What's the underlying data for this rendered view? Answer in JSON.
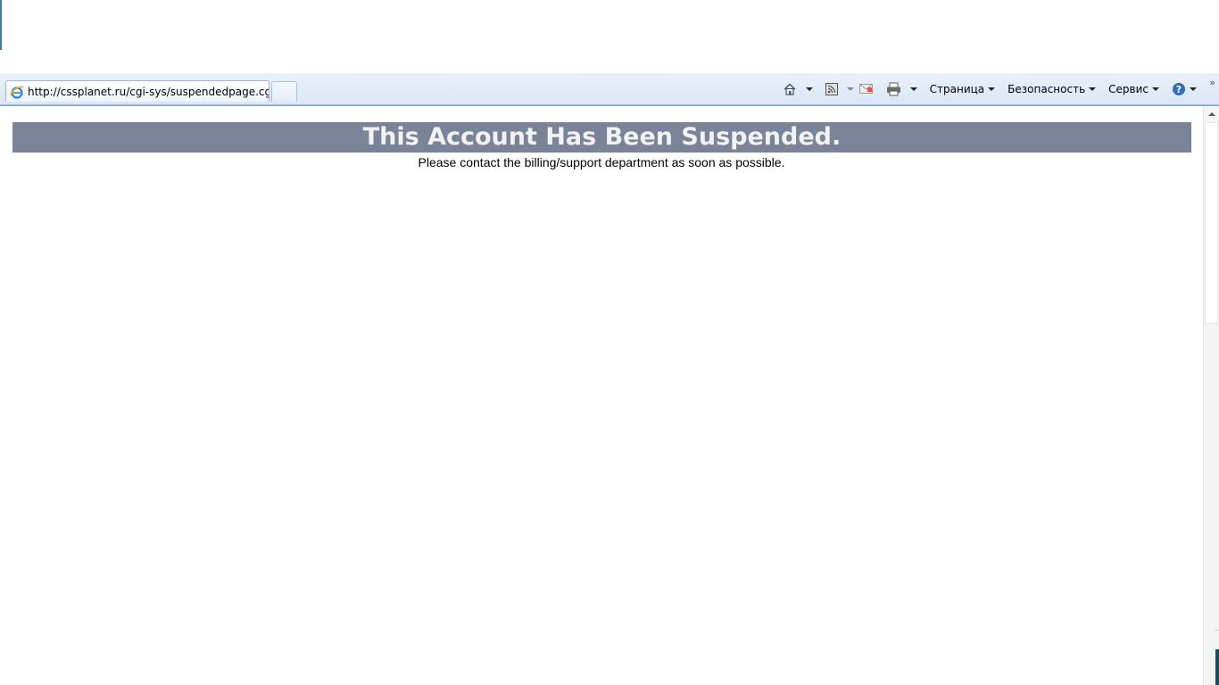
{
  "tab": {
    "url": "http://cssplanet.ru/cgi-sys/suspendedpage.cgi"
  },
  "toolbar": {
    "page_menu": "Страница",
    "security_menu": "Безопасность",
    "service_menu": "Сервис",
    "overflow": "»"
  },
  "icons": {
    "browser": "ie-icon",
    "home": "home-icon",
    "feeds": "rss-icon",
    "mail": "mail-icon",
    "print": "print-icon",
    "help": "help-icon"
  },
  "page": {
    "heading": "This Account Has Been Suspended.",
    "message": "Please contact the billing/support department as soon as possible."
  },
  "colors": {
    "banner_bg": "#7a8499",
    "banner_text": "#f2f2f2",
    "toolbar_bg": "#dbe7f6"
  }
}
